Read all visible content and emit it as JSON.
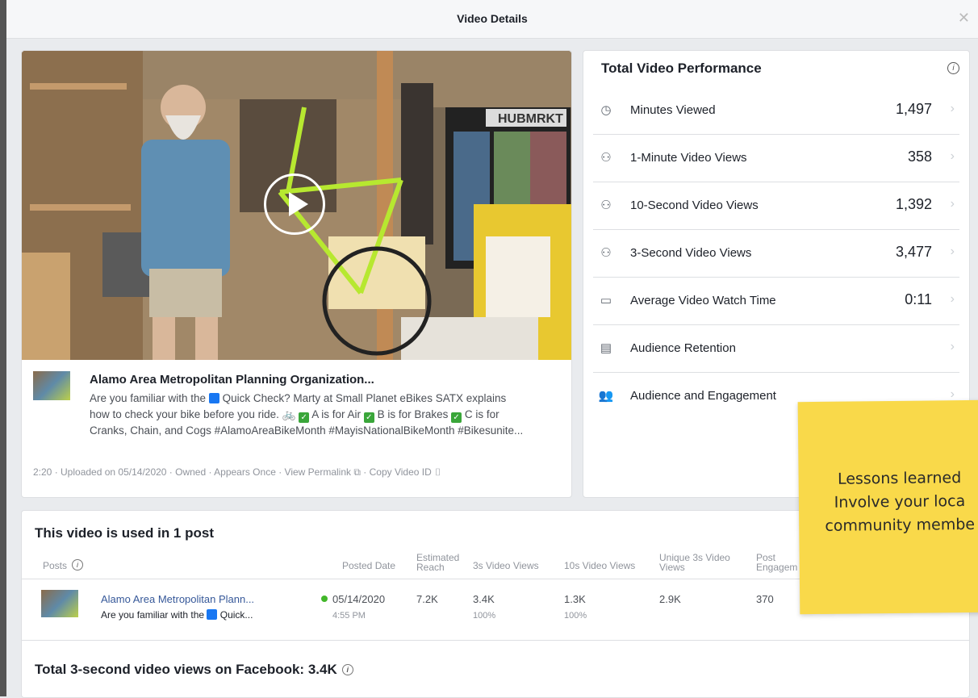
{
  "modal": {
    "title": "Video Details",
    "close_icon": "close-icon"
  },
  "video": {
    "post_title": "Alamo Area Metropolitan Planning Organization...",
    "body_line1_a": "Are you familiar with the",
    "body_line1_b": "Quick Check? Marty at Small Planet eBikes SATX explains",
    "body_line2_a": "how to check your bike before you ride.",
    "body_line2_b": "A is for Air",
    "body_line2_c": "B is for Brakes",
    "body_line2_d": "C is for",
    "body_line3": "Cranks, Chain, and Cogs #AlamoAreaBikeMonth #MayisNationalBikeMonth #Bikesunite...",
    "meta": "2:20 · Uploaded on 05/14/2020 · Owned · Appears Once · View Permalink",
    "meta_copy": "· Copy Video ID",
    "store_sign": "HUBMRKT"
  },
  "performance": {
    "title": "Total Video Performance",
    "metrics": [
      {
        "icon": "clock-icon",
        "label": "Minutes Viewed",
        "value": "1,497"
      },
      {
        "icon": "viewers-icon",
        "label": "1-Minute Video Views",
        "value": "358"
      },
      {
        "icon": "viewers-icon",
        "label": "10-Second Video Views",
        "value": "1,392"
      },
      {
        "icon": "viewers-icon",
        "label": "3-Second Video Views",
        "value": "3,477"
      },
      {
        "icon": "video-camera-icon",
        "label": "Average Video Watch Time",
        "value": "0:11"
      },
      {
        "icon": "film-icon",
        "label": "Audience Retention",
        "value": ""
      },
      {
        "icon": "people-icon",
        "label": "Audience and Engagement",
        "value": ""
      }
    ]
  },
  "posts": {
    "title": "This video is used in 1 post",
    "headers": {
      "posts": "Posts",
      "posted_date": "Posted Date",
      "reach_1": "Estimated",
      "reach_2": "Reach",
      "v3s": "3s Video Views",
      "v10s": "10s Video Views",
      "unique_1": "Unique 3s Video",
      "unique_2": "Views",
      "eng_1": "Post",
      "eng_2": "Engagem"
    },
    "row": {
      "title": "Alamo Area Metropolitan Plann...",
      "desc_a": "Are you familiar with the",
      "desc_b": "Quick...",
      "date": "05/14/2020",
      "time": "4:55 PM",
      "reach": "7.2K",
      "v3s": "3.4K",
      "v3s_pct": "100%",
      "v10s": "1.3K",
      "v10s_pct": "100%",
      "unique": "2.9K",
      "engagement": "370"
    },
    "total": "Total 3-second video views on Facebook: 3.4K"
  },
  "sticky_note": {
    "line1": "Lessons learned",
    "line2": "Involve your loca",
    "line3": "community membe"
  },
  "colors": {
    "link": "#365899",
    "sticky": "#f9d94a",
    "status_green": "#42b72a"
  }
}
